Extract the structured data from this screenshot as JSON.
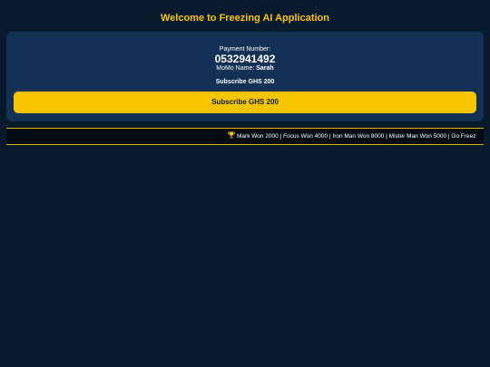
{
  "header": {
    "title": "Welcome to Freezing AI Application"
  },
  "payment": {
    "number_label": "Payment Number:",
    "number": "0532941492",
    "momo_label": "MoMo Name:",
    "momo_name": "Sarah",
    "subscribe_text": "Subscribe GHS 200",
    "subscribe_button": "Subscribe GHS 200"
  },
  "ticker": {
    "icon": "trophy-icon",
    "text": "Mark Won 2000 | Focus Won 4000 | Iron Man Won 8000 | Mister Man Won 5000 | Go Freez"
  },
  "colors": {
    "background": "#091a2d",
    "card": "#123154",
    "accent": "#f7c600",
    "ticker_background": "#020a12"
  }
}
